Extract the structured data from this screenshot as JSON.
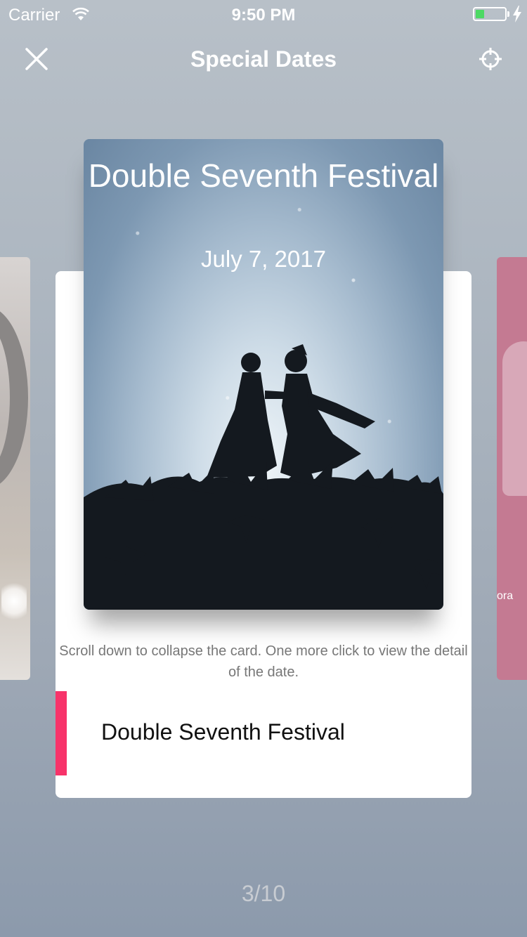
{
  "status_bar": {
    "carrier": "Carrier",
    "time": "9:50 PM",
    "battery_level": 0.3,
    "battery_color": "#4cd964"
  },
  "nav": {
    "title": "Special Dates",
    "close_icon": "close-icon",
    "locate_icon": "crosshair-icon"
  },
  "card": {
    "hero_title": "Double Seventh Festival",
    "hero_date": "July 7, 2017",
    "hint": "Scroll down to collapse the card. One more click to view  the detail of the date.",
    "name": "Double Seventh Festival",
    "accent_color": "#f7336a"
  },
  "side_right": {
    "partial_text": "ora"
  },
  "pager": {
    "label": "3/10"
  }
}
